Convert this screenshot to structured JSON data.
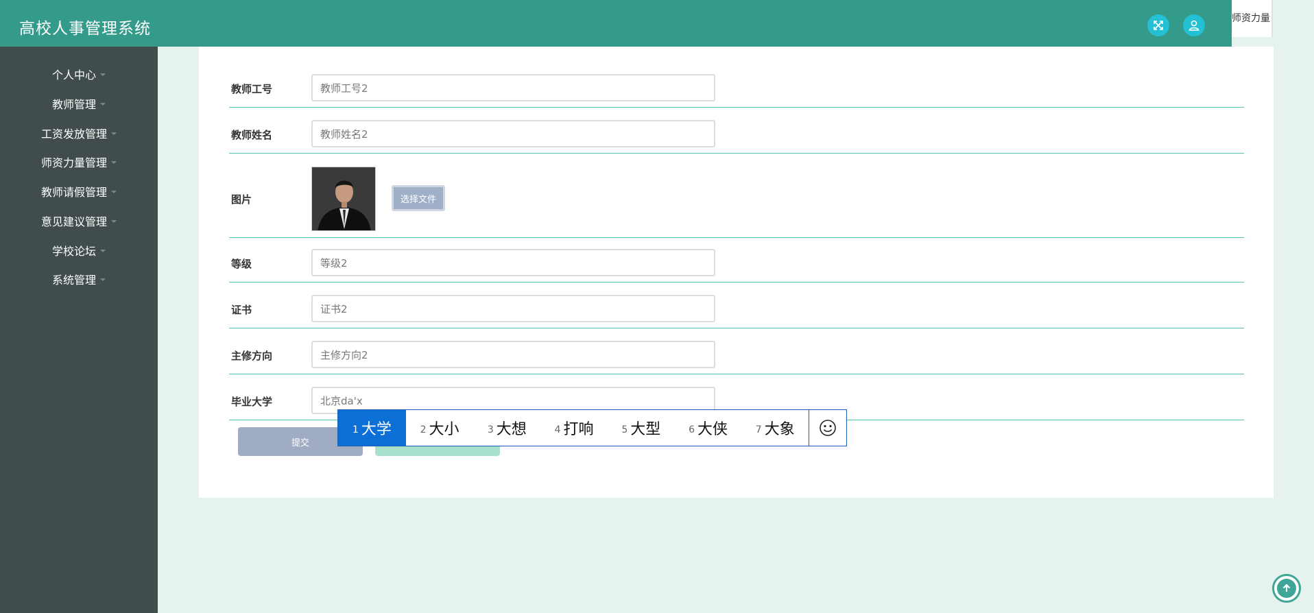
{
  "app": {
    "title": "高校人事管理系统",
    "top_tab_label": "师资力量"
  },
  "sidebar": {
    "items": [
      {
        "label": "个人中心"
      },
      {
        "label": "教师管理"
      },
      {
        "label": "工资发放管理"
      },
      {
        "label": "师资力量管理"
      },
      {
        "label": "教师请假管理"
      },
      {
        "label": "意见建议管理"
      },
      {
        "label": "学校论坛"
      },
      {
        "label": "系统管理"
      }
    ]
  },
  "form": {
    "teacher_id": {
      "label": "教师工号",
      "value": "教师工号2"
    },
    "teacher_name": {
      "label": "教师姓名",
      "value": "教师姓名2"
    },
    "photo": {
      "label": "图片",
      "file_button": "选择文件"
    },
    "level": {
      "label": "等级",
      "value": "等级2"
    },
    "certificate": {
      "label": "证书",
      "value": "证书2"
    },
    "major": {
      "label": "主修方向",
      "value": "主修方向2"
    },
    "university": {
      "label": "毕业大学",
      "value": "北京da'x"
    },
    "submit_label": "提交"
  },
  "ime": {
    "candidates": [
      {
        "num": "1",
        "text": "大学"
      },
      {
        "num": "2",
        "text": "大小"
      },
      {
        "num": "3",
        "text": "大想"
      },
      {
        "num": "4",
        "text": "打响"
      },
      {
        "num": "5",
        "text": "大型"
      },
      {
        "num": "6",
        "text": "大侠"
      },
      {
        "num": "7",
        "text": "大象"
      }
    ],
    "emoji": "☺"
  },
  "colors": {
    "header": "#349a8a",
    "sidebar": "#414c4c",
    "accent_line": "#4fc3ae",
    "ime_selected": "#0b6fd6"
  }
}
